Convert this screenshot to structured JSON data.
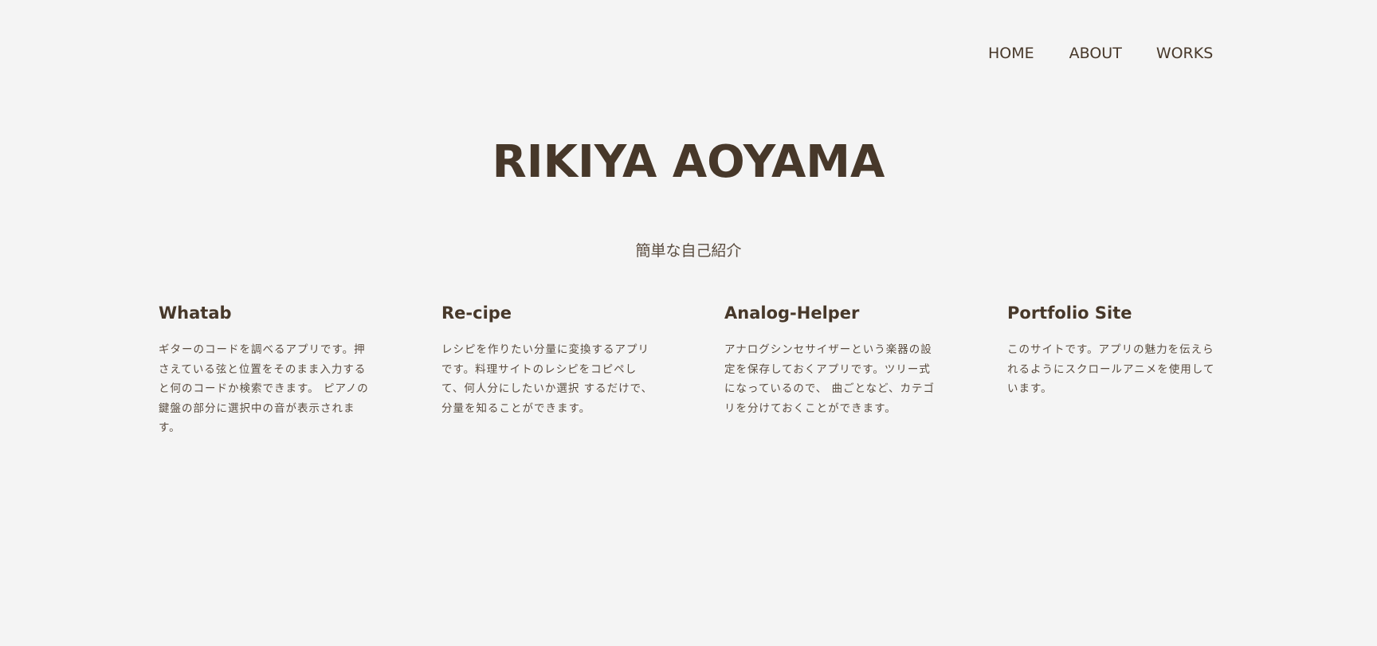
{
  "nav": {
    "home": "HOME",
    "about": "ABOUT",
    "works": "WORKS"
  },
  "hero": {
    "title": "RIKIYA AOYAMA",
    "subtitle": "簡単な自己紹介"
  },
  "works": [
    {
      "title": "Whatab",
      "description": "ギターのコードを調べるアプリです。押さえている弦と位置をそのまま入力すると何のコードか検索できます。 ピアノの鍵盤の部分に選択中の音が表示されます。"
    },
    {
      "title": "Re-cipe",
      "description": "レシピを作りたい分量に変換するアプリです。料理サイトのレシピをコピペして、何人分にしたいか選択 するだけで、分量を知ることができます。"
    },
    {
      "title": "Analog-Helper",
      "description": "アナログシンセサイザーという楽器の設定を保存しておくアプリです。ツリー式になっているので、 曲ごとなど、カテゴリを分けておくことができます。"
    },
    {
      "title": "Portfolio Site",
      "description": "このサイトです。アプリの魅力を伝えられるようにスクロールアニメを使用しています。"
    }
  ],
  "colors": {
    "background": "#f4f4f4",
    "text": "#47382a"
  }
}
